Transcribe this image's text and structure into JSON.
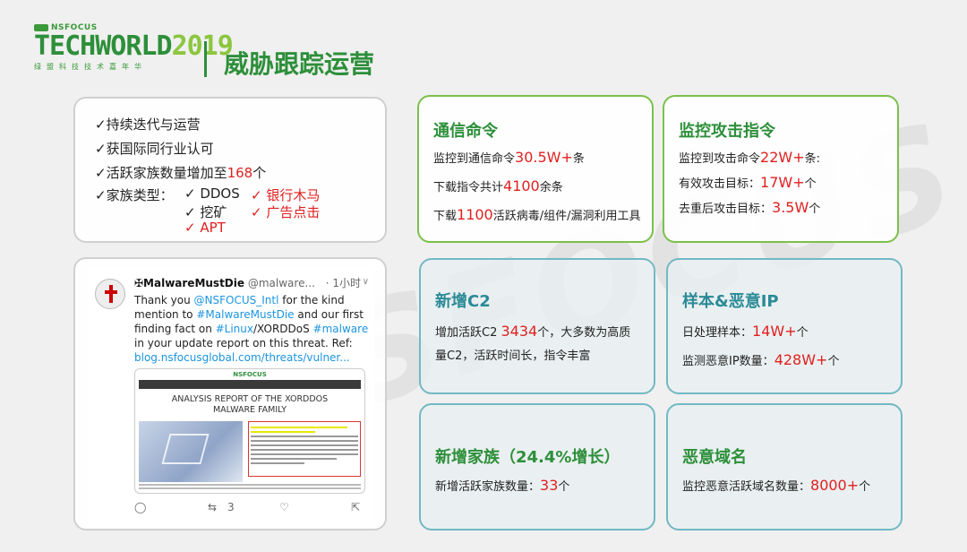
{
  "header": {
    "brand": "NSFOCUS",
    "logo_main": "TECHWORLD",
    "logo_year": "2019",
    "logo_sub": "绿盟科技技术嘉年华",
    "title": "威胁跟踪运营"
  },
  "watermark": "NSFOCUS",
  "summary": {
    "item1": "✓持续迭代与运营",
    "item2": "✓获国际同行业认可",
    "item3_prefix": "✓活跃家族数量增加至",
    "item3_value": "168",
    "item3_suffix": "个",
    "item4_label": "✓家族类型：",
    "types": {
      "ddos": "✓ DDOS",
      "bank": "✓ 银行木马",
      "mining": "✓ 挖矿",
      "ad": "✓ 广告点击",
      "apt": "✓ APT"
    }
  },
  "tweet": {
    "name": "✠MalwareMustDie",
    "handle": "@malware...",
    "time": "· 1小时",
    "text_1": "Thank you ",
    "mention_1": "@NSFOCUS_Intl",
    "text_2": " for the kind mention to ",
    "tag_1": "#MalwareMustDie",
    "text_3": " and our first finding fact on ",
    "tag_2": "#Linux",
    "text_4": "/XORDDoS ",
    "tag_3": "#malware",
    "text_5": " in your update report on this threat. Ref: ",
    "link": "blog.nsfocusglobal.com/threats/vulner...",
    "preview_logo": "NSFOCUS",
    "preview_title_1": "ANALYSIS REPORT OF THE XORDDOS",
    "preview_title_2": "MALWARE FAMILY",
    "retweet_count": "3"
  },
  "cards": {
    "c2_cmd": {
      "title": "通信命令",
      "r1_pre": "监控到通信命令",
      "r1_val": "30.5W+",
      "r1_suf": "条",
      "r2_pre": "下载指令共计",
      "r2_val": "4100",
      "r2_suf": "余条",
      "r3_pre": "下载",
      "r3_val": "1100",
      "r3_suf": "活跃病毒/组件/漏洞利用工具"
    },
    "attack_cmd": {
      "title": "监控攻击指令",
      "r1_pre": "监控到攻击命令",
      "r1_val": "22W+",
      "r1_suf": "条:",
      "r2_pre": "有效攻击目标：",
      "r2_val": "17W+",
      "r2_suf": "个",
      "r3_pre": "去重后攻击目标：",
      "r3_val": "3.5W",
      "r3_suf": "个"
    },
    "new_c2": {
      "title": "新增C2",
      "r1_pre": "增加活跃C2 ",
      "r1_val": "3434",
      "r1_suf": "个，大多数为高质",
      "r2": "量C2，活跃时间长，指令丰富"
    },
    "samples": {
      "title": "样本&恶意IP",
      "r1_pre": "日处理样本：",
      "r1_val": "14W+",
      "r1_suf": "个",
      "r2_pre": "监测恶意IP数量：",
      "r2_val": "428W+",
      "r2_suf": "个"
    },
    "new_family": {
      "title": "新增家族（24.4%增长）",
      "r1_pre": "新增活跃家族数量：",
      "r1_val": "33",
      "r1_suf": "个"
    },
    "domains": {
      "title": "恶意域名",
      "r1_pre": "监控恶意活跃域名数量：",
      "r1_val": "8000+",
      "r1_suf": "个"
    }
  },
  "colors": {
    "green": "#2d8f3a",
    "teal": "#2a8a97",
    "red": "#e02020"
  }
}
